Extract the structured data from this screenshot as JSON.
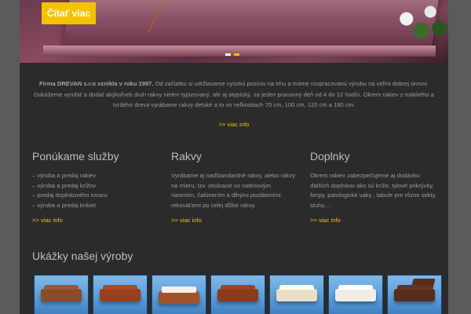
{
  "hero": {
    "button_label": "Čítať viac",
    "slides": 2,
    "active_slide": 2
  },
  "intro": {
    "bold": "Firma DREVAN s.r.o vznikla v roku 1997.",
    "text": " Od začiatku si udržiavame vysokú pozíciu na trhu a máme rozpracovanú výrobu na veľmi dobrej úrovni. Dokážeme vyrobiť a dodať akýkoľvek druh rakvy nielen typizovaný, ale aj atypický, za jeden pracovný deň od 4 do 12 hodín. Okrem rakiev z mäkkého a tvrdého dreva vyrábame rakvy detské a to vo veľkostiach 70 cm, 100 cm, 120 cm a 160 cm.",
    "more": ">> viac info"
  },
  "columns": [
    {
      "title": "Ponúkame služby",
      "items": [
        "– výroba a predaj rakiev",
        "– výroba a predaj krížov",
        "– predaj doplnkového tovaru",
        "– výroba a predaj brikiet"
      ],
      "more": ">> viac info"
    },
    {
      "title": "Rakvy",
      "text": "Vyrábame aj nadštandardné rakvy, alebo rakvy na mieru, tzv. otváracie so saténovým riasením, čalúnením a dlhými pozláteními rekoväťami po celej dĺžke rakvy.",
      "more": ">> viac info"
    },
    {
      "title": "Doplnky",
      "text": "Okrem rakiev zabezpečujeme aj dodávku ďalších doplnkov ako sú kríže, tylové prikrývky, šerpy, patologické vaky , tabule pre rôzne sekty, stuhy....",
      "more": ">> viac info"
    }
  ],
  "gallery": {
    "title": "Ukážky našej výroby",
    "thumbs": [
      {
        "name": "coffin-thumb-1",
        "color": "#8a4b2a"
      },
      {
        "name": "coffin-thumb-2",
        "color": "#9a3f1e"
      },
      {
        "name": "coffin-thumb-3",
        "color": "#a0522d"
      },
      {
        "name": "coffin-thumb-4",
        "color": "#8b3a1c"
      },
      {
        "name": "coffin-thumb-5",
        "color": "#e9dfc8"
      },
      {
        "name": "coffin-thumb-6",
        "color": "#f1ede6"
      },
      {
        "name": "coffin-thumb-7",
        "color": "#5a2c1c"
      }
    ]
  },
  "colors": {
    "accent": "#f3c300",
    "background": "#2b2b2b",
    "outer": "#5b5b5b"
  }
}
